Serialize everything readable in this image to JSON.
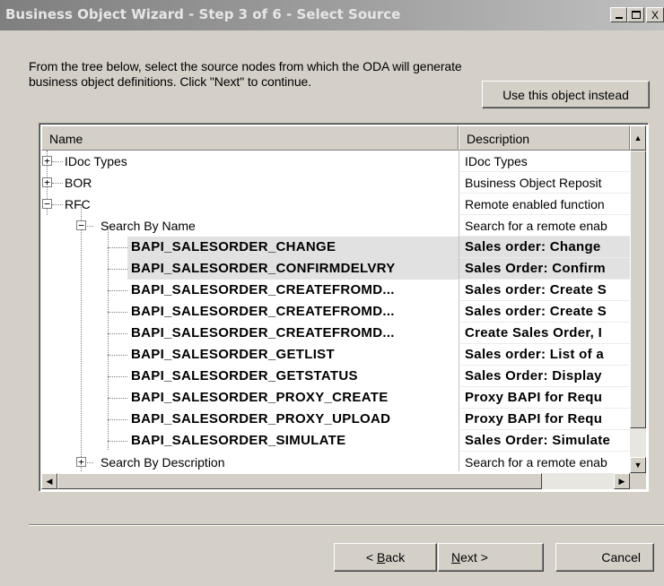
{
  "window": {
    "title": "Business Object Wizard - Step 3 of 6 - Select Source",
    "controls": {
      "minimize_icon": "minimize-icon",
      "maximize_icon": "maximize-icon",
      "close_glyph": "X"
    }
  },
  "instruction": "From the tree below, select the source nodes from which the ODA will generate business object definitions. Click \"Next\" to continue.",
  "use_object_button": "Use this object instead",
  "tree": {
    "columns": {
      "name": "Name",
      "description": "Description"
    },
    "rows": [
      {
        "name": "IDoc Types",
        "description": "IDoc Types"
      },
      {
        "name": "BOR",
        "description": "Business Object Reposit"
      },
      {
        "name": "RFC",
        "description": "Remote enabled function"
      },
      {
        "name": "Search By Name",
        "description": "Search for a remote enab"
      },
      {
        "name": "BAPI_SALESORDER_CHANGE",
        "description": "Sales order: Change"
      },
      {
        "name": "BAPI_SALESORDER_CONFIRMDELVRY",
        "description": "Sales Order: Confirm"
      },
      {
        "name": "BAPI_SALESORDER_CREATEFROMD...",
        "description": "Sales order: Create S"
      },
      {
        "name": "BAPI_SALESORDER_CREATEFROMD...",
        "description": "Sales order: Create S"
      },
      {
        "name": "BAPI_SALESORDER_CREATEFROMD...",
        "description": "Create Sales Order, I"
      },
      {
        "name": "BAPI_SALESORDER_GETLIST",
        "description": "Sales order: List of a"
      },
      {
        "name": "BAPI_SALESORDER_GETSTATUS",
        "description": "Sales Order: Display"
      },
      {
        "name": "BAPI_SALESORDER_PROXY_CREATE",
        "description": "Proxy BAPI for Requ"
      },
      {
        "name": "BAPI_SALESORDER_PROXY_UPLOAD",
        "description": "Proxy BAPI for Requ"
      },
      {
        "name": "BAPI_SALESORDER_SIMULATE",
        "description": "Sales Order: Simulate"
      },
      {
        "name": "Search By Description",
        "description": "Search for a remote enab"
      }
    ],
    "expanders": {
      "plus": "+",
      "minus": "−"
    },
    "scroll_arrows": {
      "up": "▲",
      "down": "▼",
      "left": "◀",
      "right": "▶"
    }
  },
  "buttons": {
    "back_prefix": "< ",
    "back_accel": "B",
    "back_rest": "ack",
    "next_accel": "N",
    "next_rest": "ext >",
    "cancel": "Cancel"
  }
}
